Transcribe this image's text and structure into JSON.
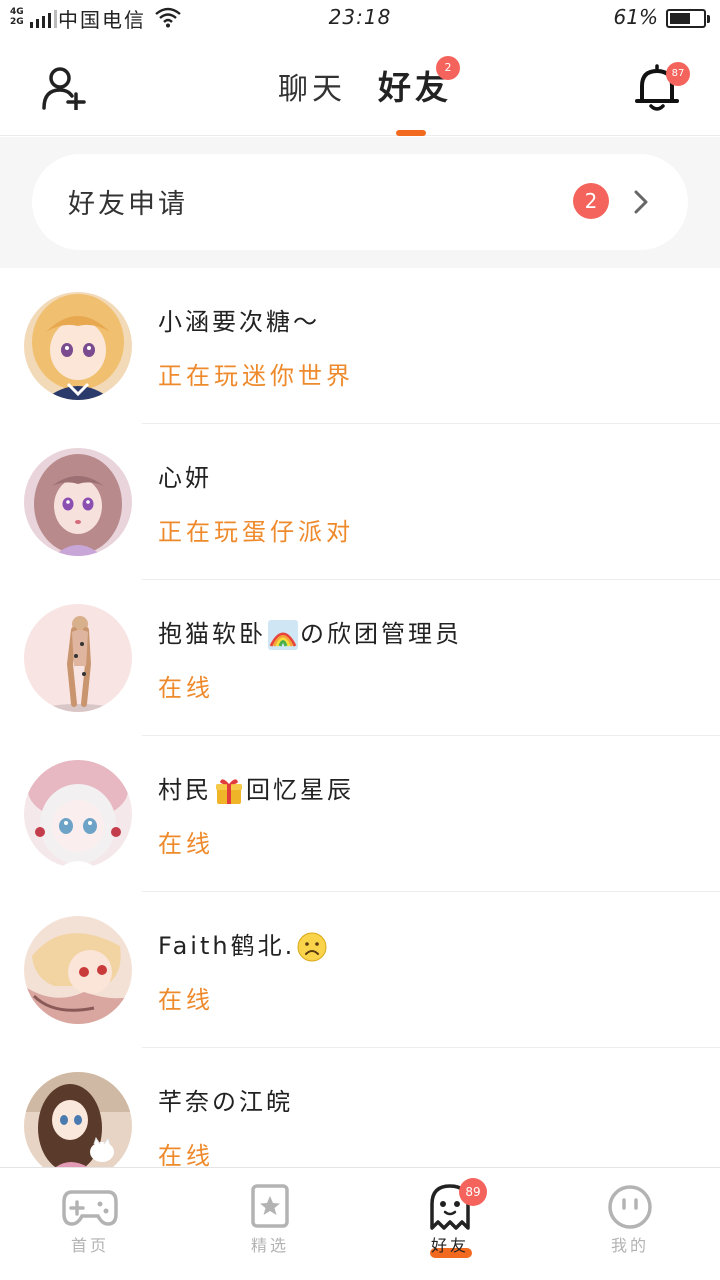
{
  "status_bar": {
    "network_top": "4G",
    "network_bottom": "2G",
    "carrier": "中国电信",
    "time": "23:18",
    "battery_percent": "61%",
    "battery_level": 0.61
  },
  "header": {
    "tabs": [
      {
        "label": "聊天",
        "active": false
      },
      {
        "label": "好友",
        "active": true,
        "badge": "2"
      }
    ],
    "notification_badge": "87",
    "accent_color": "#f26a20"
  },
  "friend_requests": {
    "label": "好友申请",
    "count": "2"
  },
  "friends": [
    {
      "name": "小涵要次糖～",
      "status": "正在玩迷你世界",
      "avatar": "anime-blonde-girl"
    },
    {
      "name": "心妍",
      "status": "正在玩蛋仔派对",
      "avatar": "anime-pink-hair-girl"
    },
    {
      "name_before": "抱猫软卧",
      "emoji": "rainbow-emoji",
      "name_after": "の欣团管理员",
      "status": "在线",
      "avatar": "figure-on-pink"
    },
    {
      "name_before": "村民",
      "emoji": "gift-emoji",
      "name_after": "回忆星辰",
      "status": "在线",
      "avatar": "anime-white-hair-girl"
    },
    {
      "name_before": "Faith鹤北.",
      "emoji": "sad-face-emoji",
      "name_after": "",
      "status": "在线",
      "avatar": "anime-blonde-red-eyes"
    },
    {
      "name": "芊奈の江皖",
      "status": "在线",
      "avatar": "anime-brown-hair-cat"
    }
  ],
  "bottom_nav": {
    "items": [
      {
        "label": "首页",
        "icon": "gamepad-icon"
      },
      {
        "label": "精选",
        "icon": "star-bookmark-icon"
      },
      {
        "label": "好友",
        "icon": "ghost-icon",
        "active": true,
        "badge": "89"
      },
      {
        "label": "我的",
        "icon": "face-icon"
      }
    ]
  },
  "colors": {
    "badge": "#f4645d",
    "status_orange": "#ee8a2c"
  }
}
